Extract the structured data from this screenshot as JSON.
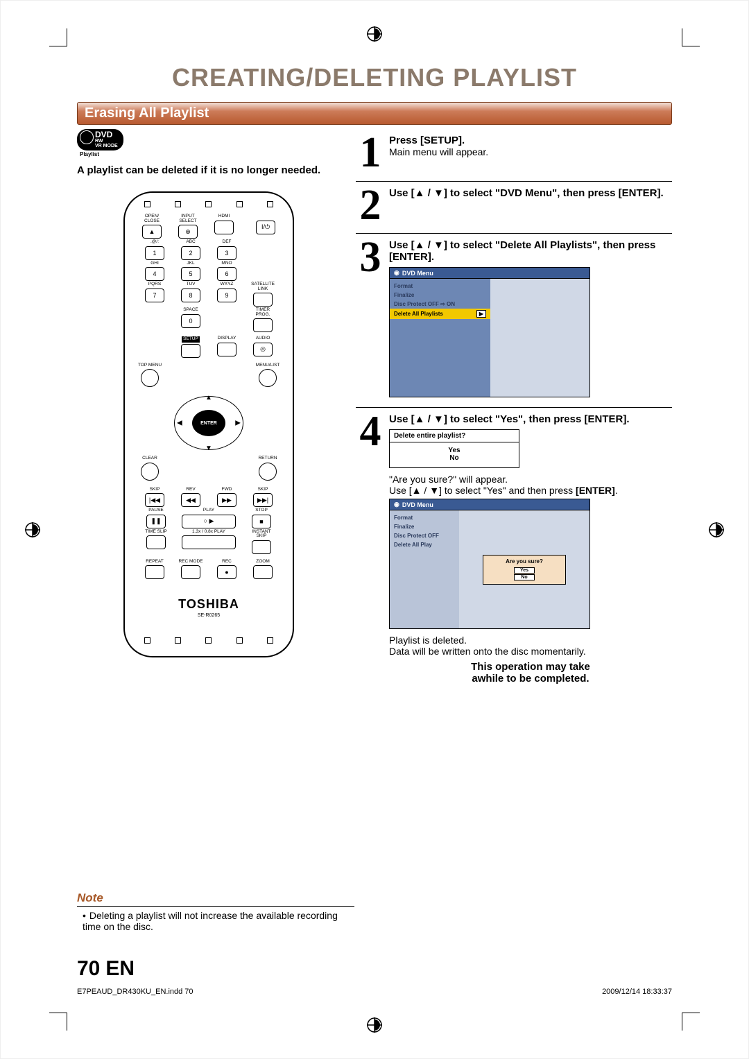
{
  "title": "CREATING/DELETING PLAYLIST",
  "section_bar": "Erasing All Playlist",
  "dvd_badge": {
    "main": "DVD",
    "sub": "RW\nVR MODE",
    "playlist": "Playlist"
  },
  "intro": "A playlist can be deleted if it is no longer needed.",
  "remote": {
    "labels": {
      "open_close": "OPEN/\nCLOSE",
      "input_select": "INPUT\nSELECT",
      "hdmi": "HDMI",
      "at": ".@/:",
      "abc": "ABC",
      "def": "DEF",
      "ghi": "GHI",
      "jkl": "JKL",
      "mno": "MNO",
      "pqrs": "PQRS",
      "tuv": "TUV",
      "wxyz": "WXYZ",
      "satlink": "SATELLITE\nLINK",
      "space": "SPACE",
      "timer": "TIMER\nPROG.",
      "setup": "SETUP",
      "display": "DISPLAY",
      "audio": "AUDIO",
      "top_menu": "TOP MENU",
      "menu_list": "MENU/LIST",
      "clear": "CLEAR",
      "return": "RETURN",
      "enter": "ENTER",
      "skip": "SKIP",
      "rev": "REV",
      "fwd": "FWD",
      "pause": "PAUSE",
      "play": "PLAY",
      "stop": "STOP",
      "time_slip": "TIME SLIP",
      "speed": "1.3x / 0.8x PLAY",
      "instant_skip": "INSTANT SKIP",
      "repeat": "REPEAT",
      "rec_mode": "REC MODE",
      "rec": "REC",
      "zoom": "ZOOM"
    },
    "keys": {
      "k1": "1",
      "k2": "2",
      "k3": "3",
      "k4": "4",
      "k5": "5",
      "k6": "6",
      "k7": "7",
      "k8": "8",
      "k9": "9",
      "k0": "0"
    },
    "brand": "TOSHIBA",
    "model": "SE-R0265",
    "power_glyph": "I/⏻"
  },
  "steps": [
    {
      "num": "1",
      "title": "Press [SETUP].",
      "sub": "Main menu will appear."
    },
    {
      "num": "2",
      "title": "Use [▲ / ▼] to select \"DVD Menu\", then press [ENTER]."
    },
    {
      "num": "3",
      "title": "Use [▲ / ▼] to select \"Delete All Playlists\", then press [ENTER].",
      "osd": {
        "header": "DVD Menu",
        "items": [
          "Format",
          "Finalize",
          "Disc Protect OFF ⇨ ON"
        ],
        "highlight": "Delete All Playlists",
        "arrow": "▶"
      }
    },
    {
      "num": "4",
      "title": "Use [▲ / ▼] to select \"Yes\", then press [ENTER].",
      "mini": {
        "q": "Delete entire playlist?",
        "yes": "Yes",
        "no": "No"
      },
      "after1": "\"Are you sure?\" will appear.",
      "after2a": "Use [▲ / ▼] to select \"Yes\" and then press",
      "after2b": "[ENTER]",
      "osd2": {
        "header": "DVD Menu",
        "items": [
          "Format",
          "Finalize",
          "Disc Protect OFF",
          "Delete All Play"
        ],
        "popup_q": "Are you sure?",
        "popup_yes": "Yes",
        "popup_no": "No"
      },
      "closing1": "Playlist is deleted.",
      "closing2": "Data will be written onto the disc momentarily.",
      "warn1": "This operation may take",
      "warn2": "awhile to be completed."
    }
  ],
  "note": {
    "heading": "Note",
    "bullet": "•",
    "text": "Deleting a playlist will not increase the available recording time on the disc."
  },
  "footer": {
    "page": "70",
    "lang": "EN",
    "file": "E7PEAUD_DR430KU_EN.indd   70",
    "timestamp": "2009/12/14   18:33:37"
  }
}
